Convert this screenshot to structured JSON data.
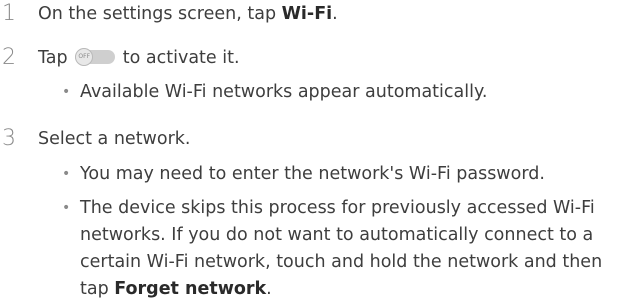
{
  "steps": [
    {
      "number": "1",
      "text_before": "On the settings screen, tap ",
      "bold": "Wi-Fi",
      "text_after": "."
    },
    {
      "number": "2",
      "text_before": "Tap ",
      "toggle_label": "OFF",
      "text_after": " to activate it.",
      "bullets": [
        "Available Wi-Fi networks appear automatically."
      ]
    },
    {
      "number": "3",
      "text": "Select a network.",
      "bullet1": "You may need to enter the network's Wi-Fi password.",
      "bullet2": {
        "line1": "The device skips this process for previously accessed Wi-Fi",
        "line2": "networks. If you do not want to automatically connect to a",
        "line3": "certain Wi-Fi network, touch and hold the network and then",
        "line4_before": "tap ",
        "line4_bold": "Forget network",
        "line4_after": "."
      }
    }
  ],
  "bullet_char": "•"
}
